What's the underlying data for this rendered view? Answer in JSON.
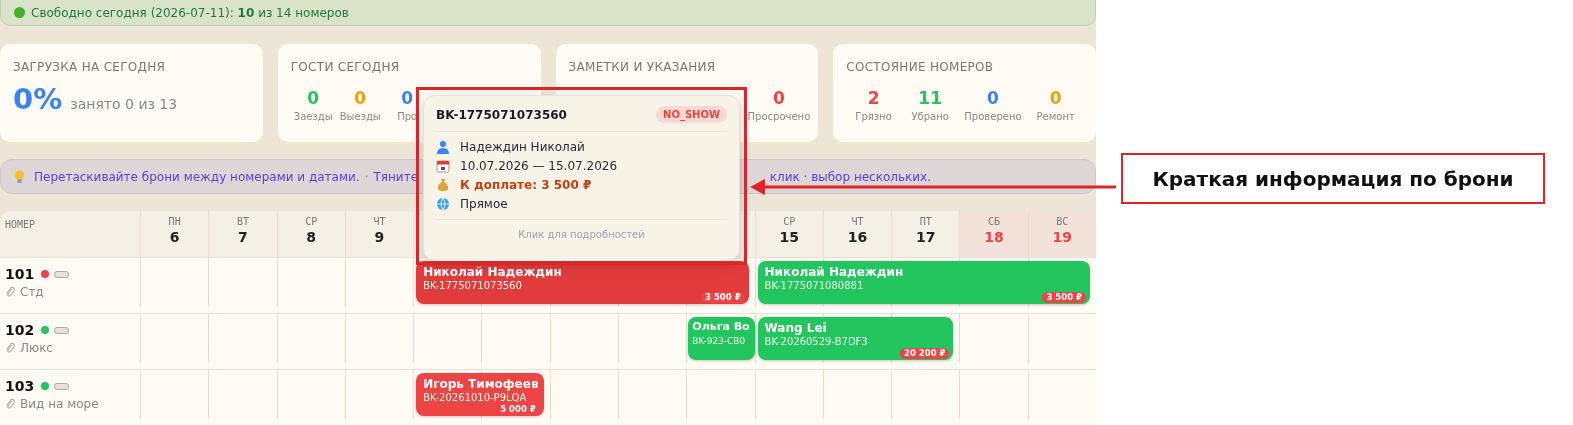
{
  "banner": {
    "text": "Свободно сегодня (2026-07-11): **10** из 14 номеров"
  },
  "cards": [
    {
      "kind": "load",
      "title": "ЗАГРУЗКА НА СЕГОДНЯ",
      "value": "0%",
      "caption": "занято 0 из 13"
    },
    {
      "kind": "guests",
      "title": "ГОСТИ СЕГОДНЯ",
      "stats": [
        {
          "value": "0",
          "label": "Заезды",
          "color": "#22c55e"
        },
        {
          "value": "0",
          "label": "Выезды",
          "color": "#f59e0b"
        },
        {
          "value": "0",
          "label": "Про",
          "color": "#3b82f6"
        }
      ]
    },
    {
      "kind": "notes",
      "title": "ЗАМЕТКИ И УКАЗАНИЯ",
      "stats": [
        {
          "value": "0",
          "label": "Просрочено",
          "color": "#ef4444"
        }
      ]
    },
    {
      "kind": "rooms",
      "title": "СОСТОЯНИЕ НОМЕРОВ",
      "stats": [
        {
          "value": "2",
          "label": "Грязно",
          "color": "#ef4444"
        },
        {
          "value": "11",
          "label": "Убрано",
          "color": "#22c55e"
        },
        {
          "value": "0",
          "label": "Проверено",
          "color": "#3b82f6"
        },
        {
          "value": "0",
          "label": "Ремонт",
          "color": "#f59e0b"
        }
      ]
    }
  ],
  "hint": {
    "left": "Перетаскивайте брони между номерами и датами.",
    "separator": "·",
    "middle": "Тяните",
    "right": "клик · выбор нескольких."
  },
  "grid": {
    "room_column": "НОМЕР",
    "days_before": [
      {
        "weekday": "ПН",
        "day": "6",
        "weekend": false
      },
      {
        "weekday": "ВТ",
        "day": "7",
        "weekend": false
      },
      {
        "weekday": "СР",
        "day": "8",
        "weekend": false
      },
      {
        "weekday": "ЧТ",
        "day": "9",
        "weekend": false
      }
    ],
    "days_after": [
      {
        "weekday": "СР",
        "day": "15",
        "weekend": false
      },
      {
        "weekday": "ЧТ",
        "day": "16",
        "weekend": false
      },
      {
        "weekday": "ПТ",
        "day": "17",
        "weekend": false
      },
      {
        "weekday": "СБ",
        "day": "18",
        "weekend": true
      },
      {
        "weekday": "ВС",
        "day": "19",
        "weekend": true
      }
    ],
    "rooms": [
      {
        "number": "101",
        "color": "#ef4444",
        "type": "Стд",
        "bookings": [
          {
            "guest": "Николай Надеждин",
            "id": "BK-1775071073560",
            "price": "3 500 ₽",
            "color": "#e23b3b"
          },
          {
            "guest": "Николай Надеждин",
            "id": "BK-1775071080881",
            "price": "3 500 ₽",
            "color": "#22c55e"
          }
        ]
      },
      {
        "number": "102",
        "color": "#22c55e",
        "type": "Люкс",
        "bookings": [
          {
            "guest": "Ольга Во",
            "id": "BK-923-CB0",
            "color": "#22c55e"
          },
          {
            "guest": "Wang Lei",
            "id": "BK-20260529-B7DF3",
            "price": "20 200 ₽",
            "color": "#22c55e"
          }
        ]
      },
      {
        "number": "103",
        "color": "#22c55e",
        "type": "Вид на море",
        "bookings": [
          {
            "guest": "Игорь Тимофеев",
            "id": "BK-20261010-P9LQA",
            "price": "5 000 ₽",
            "color": "#ef4444"
          }
        ]
      }
    ]
  },
  "tooltip": {
    "id": "BK-1775071073560",
    "status": "NO_SHOW",
    "guest": "Надеждин Николай",
    "dates": "10.07.2026 — 15.07.2026",
    "due": "К доплате: 3 500 ₽",
    "source": "Прямое",
    "footer": "Клик для подробностей"
  },
  "annotation": {
    "label": "Краткая информация по брони"
  }
}
